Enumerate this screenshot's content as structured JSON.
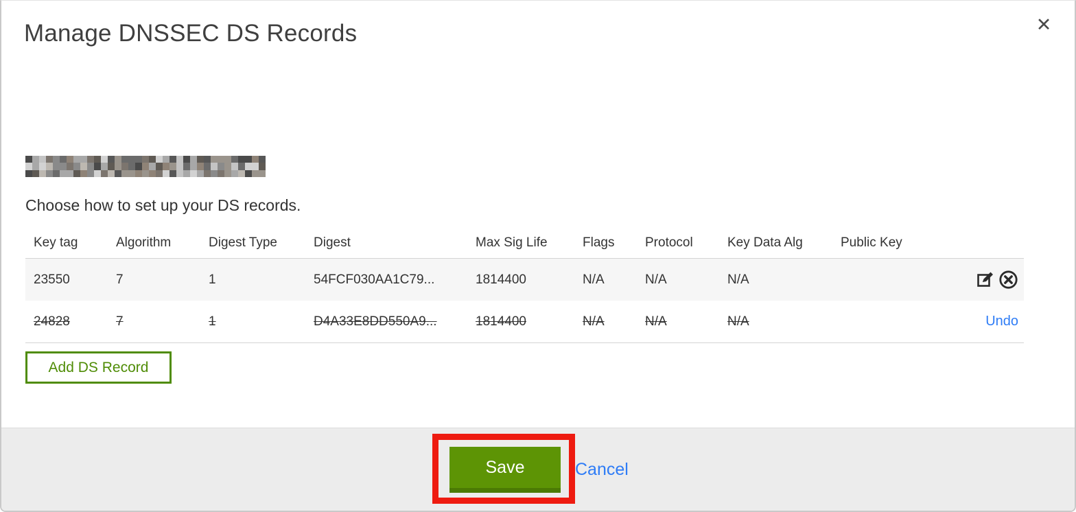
{
  "dialog": {
    "title": "Manage DNSSEC DS Records",
    "close_glyph": "✕",
    "intro": "Choose how to set up your DS records.",
    "domain_redacted": true
  },
  "table": {
    "headers": {
      "key_tag": "Key tag",
      "algorithm": "Algorithm",
      "digest_type": "Digest Type",
      "digest": "Digest",
      "max_sig_life": "Max Sig Life",
      "flags": "Flags",
      "protocol": "Protocol",
      "key_data_alg": "Key Data Alg",
      "public_key": "Public Key"
    },
    "rows": [
      {
        "key_tag": "23550",
        "algorithm": "7",
        "digest_type": "1",
        "digest": "54FCF030AA1C79...",
        "max_sig_life": "1814400",
        "flags": "N/A",
        "protocol": "N/A",
        "key_data_alg": "N/A",
        "public_key": "",
        "state": "normal"
      },
      {
        "key_tag": "24828",
        "algorithm": "7",
        "digest_type": "1",
        "digest": "D4A33E8DD550A9...",
        "max_sig_life": "1814400",
        "flags": "N/A",
        "protocol": "N/A",
        "key_data_alg": "N/A",
        "public_key": "",
        "state": "deleted",
        "undo_label": "Undo"
      }
    ]
  },
  "buttons": {
    "add_ds_record": "Add DS Record",
    "save": "Save",
    "cancel": "Cancel"
  },
  "colors": {
    "green": "#5d9405",
    "green_dark": "#4b7a04",
    "green_outline": "#4f8c06",
    "link_blue": "#2e7cf6",
    "annotation_red": "#ee1b10",
    "footer_bg": "#ececec",
    "row_alt_bg": "#f6f6f6"
  }
}
